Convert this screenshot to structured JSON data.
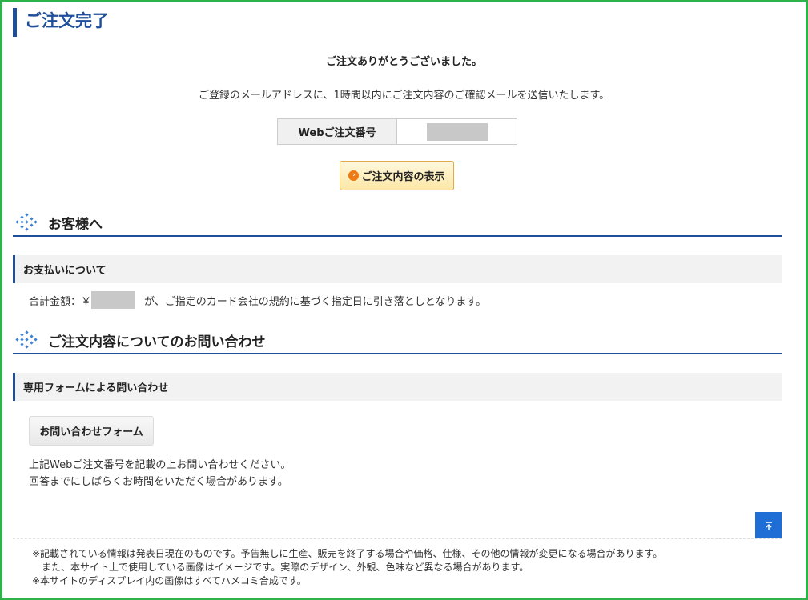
{
  "page": {
    "title": "ご注文完了"
  },
  "confirmation": {
    "thanks": "ご注文ありがとうございました。",
    "notice": "ご登録のメールアドレスに、1時間以内にご注文内容のご確認メールを送信いたします。",
    "order_number_label": "Webご注文番号",
    "show_button": "ご注文内容の表示"
  },
  "customer": {
    "heading": "お客様へ",
    "payment_heading": "お支払いについて",
    "total_prefix": "合計金額：￥",
    "total_suffix": "が、ご指定のカード会社の規約に基づく指定日に引き落としとなります。"
  },
  "inquiry": {
    "heading": "ご注文内容についてのお問い合わせ",
    "form_heading": "専用フォームによる問い合わせ",
    "form_button": "お問い合わせフォーム",
    "note_line1": "上記Webご注文番号を記載の上お問い合わせください。",
    "note_line2": "回答までにしばらくお時間をいただく場合があります。"
  },
  "footer": {
    "line1": "※記載されている情報は発表日現在のものです。予告無しに生産、販売を終了する場合や価格、仕様、その他の情報が変更になる場合があります。",
    "line2": "　また、本サイト上で使用している画像はイメージです。実際のデザイン、外観、色味など異なる場合があります。",
    "line3": "※本サイトのディスプレイ内の画像はすべてハメコミ合成です。"
  },
  "colors": {
    "accent": "#1f4f9a",
    "frame": "#2db34a",
    "button_orange": "#ee7a13",
    "pagetop": "#1e6ed6"
  },
  "icons": {
    "section": "diamond-dots-icon",
    "arrow": "arrow-circle-icon",
    "pagetop": "arrow-up-icon"
  }
}
